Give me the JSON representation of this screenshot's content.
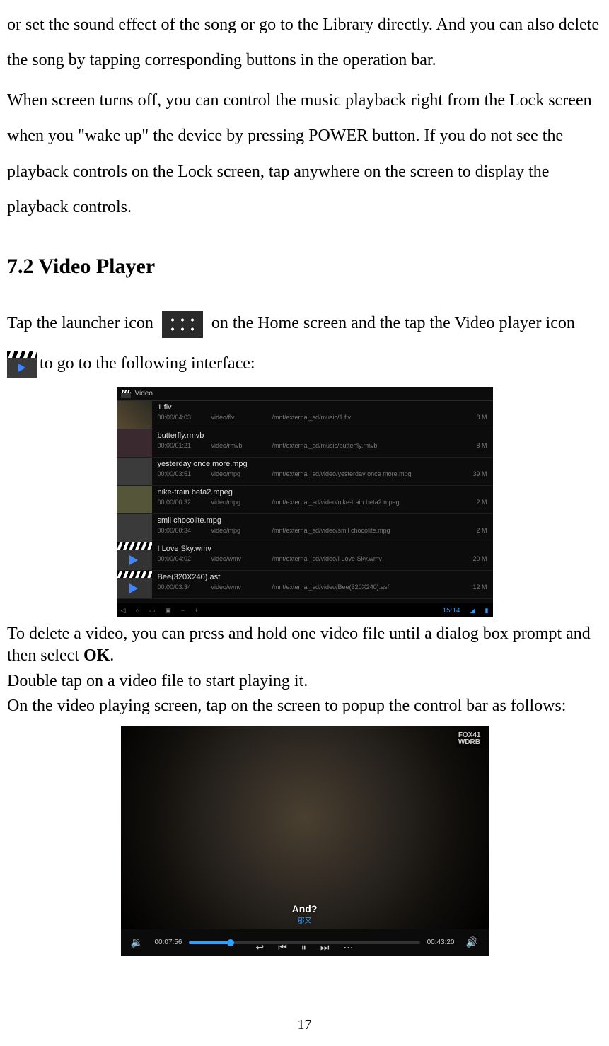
{
  "para1": "or set the sound effect of the song or go to the Library directly. And you can also delete the song by tapping corresponding buttons in the operation bar.",
  "para2": "When screen turns off, you can control the music playback right from the Lock screen when you \"wake up\" the device by pressing POWER button. If you do not see the playback controls on the Lock screen, tap anywhere on the screen to display the playback controls.",
  "heading": "7.2 Video Player",
  "line_tap_pre": "Tap the launcher icon ",
  "line_tap_post": " on the Home screen and the tap the Video player icon",
  "line_togoto": "to go to the following interface:",
  "delete_line_pre": "To delete a video, you can press and hold one video file until a dialog box prompt and then select ",
  "delete_bold": "OK",
  "delete_line_post": ".",
  "double_tap": "Double tap on a video file to start playing it.",
  "on_playing": "On the video playing screen, tap on the screen to popup the control bar as follows:",
  "pagenum": "17",
  "screenshot1": {
    "title": "Video",
    "clock": "15:14",
    "rows": [
      {
        "name": "1.flv",
        "dur": "00:00/04:03",
        "type": "video/flv",
        "path": "/mnt/external_sd/music/1.flv",
        "size": "8 M",
        "thumb": "img1"
      },
      {
        "name": "butterfly.rmvb",
        "dur": "00:00/01:21",
        "type": "video/rmvb",
        "path": "/mnt/external_sd/music/butterfly.rmvb",
        "size": "8 M",
        "thumb": "img2"
      },
      {
        "name": "yesterday once more.mpg",
        "dur": "00:00/03:51",
        "type": "video/mpg",
        "path": "/mnt/external_sd/video/yesterday once more.mpg",
        "size": "39 M",
        "thumb": "img3"
      },
      {
        "name": "nike-train beta2.mpeg",
        "dur": "00:00/00:32",
        "type": "video/mpg",
        "path": "/mnt/external_sd/video/nike-train beta2.mpeg",
        "size": "2 M",
        "thumb": "img4"
      },
      {
        "name": "smil chocolite.mpg",
        "dur": "00:00/00:34",
        "type": "video/mpg",
        "path": "/mnt/external_sd/video/smil chocolite.mpg",
        "size": "2 M",
        "thumb": "img5"
      },
      {
        "name": "I Love Sky.wmv",
        "dur": "00:00/04:02",
        "type": "video/wmv",
        "path": "/mnt/external_sd/video/I Love Sky.wmv",
        "size": "20 M",
        "thumb": "clapthumb"
      },
      {
        "name": "Bee(320X240).asf",
        "dur": "00:00/03:34",
        "type": "video/wmv",
        "path": "/mnt/external_sd/video/Bee(320X240).asf",
        "size": "12 M",
        "thumb": "clapthumb"
      }
    ]
  },
  "screenshot2": {
    "logo1": "FOX41",
    "logo2": "WDRB",
    "subtitle": "And?",
    "subtitle2": "那又",
    "t1": "00:07:56",
    "t2": "00:43:20"
  }
}
